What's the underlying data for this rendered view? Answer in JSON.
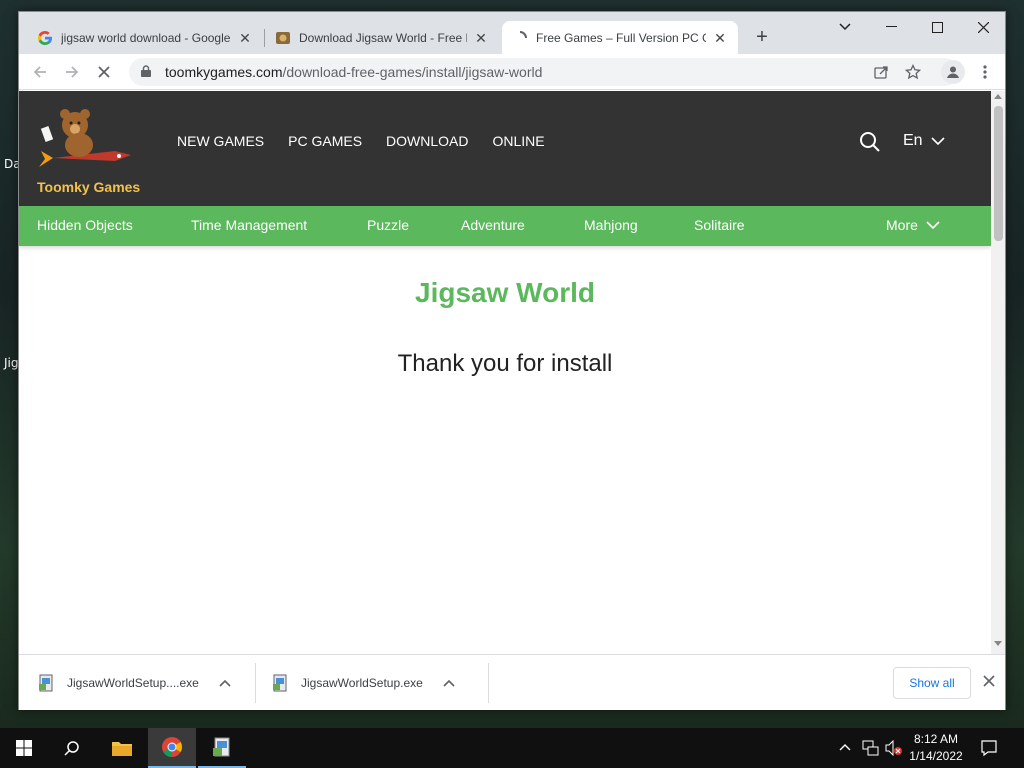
{
  "desktop": {
    "icon_labels": [
      "Da",
      "Jig"
    ]
  },
  "browser": {
    "tabs": [
      {
        "title": "jigsaw world download - Google",
        "favicon": "google-g-icon"
      },
      {
        "title": "Download Jigsaw World - Free P",
        "favicon": "site-favicon"
      },
      {
        "title": "Free Games – Full Version PC Ga",
        "favicon": "loading-icon",
        "active": true
      }
    ],
    "address": {
      "host": "toomkygames.com",
      "path": "/download-free-games/install/jigsaw-world"
    }
  },
  "site": {
    "logo_text": "Toomky Games",
    "nav": [
      "NEW GAMES",
      "PC GAMES",
      "DOWNLOAD",
      "ONLINE"
    ],
    "language": "En",
    "categories": [
      "Hidden Objects",
      "Time Management",
      "Puzzle",
      "Adventure",
      "Mahjong",
      "Solitaire"
    ],
    "more_label": "More",
    "colors": {
      "header": "#333333",
      "accent": "#5cb85c",
      "logo": "#f2c14e"
    }
  },
  "page": {
    "title": "Jigsaw World",
    "message": "Thank you for install"
  },
  "downloads": {
    "items": [
      "JigsawWorldSetup....exe",
      "JigsawWorldSetup.exe"
    ],
    "show_all": "Show all"
  },
  "taskbar": {
    "time": "8:12 AM",
    "date": "1/14/2022"
  }
}
